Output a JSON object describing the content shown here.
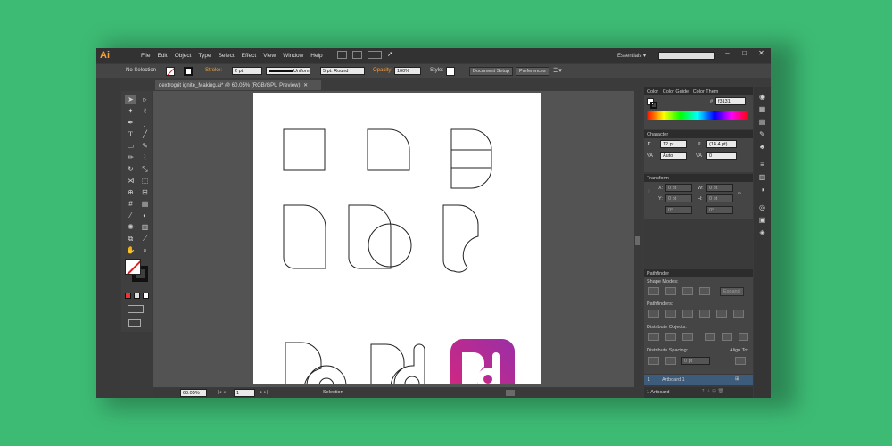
{
  "app": {
    "logo": "Ai"
  },
  "menu": [
    "File",
    "Edit",
    "Object",
    "Type",
    "Select",
    "Effect",
    "View",
    "Window",
    "Help"
  ],
  "workspace": {
    "label": "Essentials",
    "arrow": "▾"
  },
  "window_controls": {
    "minimize": "–",
    "maximize": "□",
    "close": "✕"
  },
  "control_bar": {
    "selection": "No Selection",
    "stroke_label": "Stroke:",
    "stroke_weight": "2 pt",
    "profile": "Uniform",
    "brush": "5 pt. Round",
    "opacity_label": "Opacity:",
    "opacity_value": "100%",
    "style_label": "Style:",
    "doc_setup": "Document Setup",
    "preferences": "Preferences"
  },
  "document_tab": {
    "title": "dextrogrit ignite_Making.ai* @ 60.05% (RGB/GPU Preview)",
    "close": "✕"
  },
  "color_panel": {
    "tabs": [
      "Color",
      "Color Guide",
      "Color Them"
    ],
    "hex_symbol": "#",
    "hex_value": "f3131"
  },
  "character_panel": {
    "title": "Character",
    "font_size": "12 pt",
    "leading": "(14.4 pt)",
    "kerning": "Auto",
    "tracking": "0"
  },
  "transform_panel": {
    "title": "Transform",
    "x_label": "X:",
    "x_value": "0 pt",
    "y_label": "Y:",
    "y_value": "0 pt",
    "w_label": "W:",
    "w_value": "0 pt",
    "h_label": "H:",
    "h_value": "0 pt",
    "angle": "0°",
    "shear": "0°"
  },
  "pathfinder_panel": {
    "title": "Pathfinder",
    "shape_modes": "Shape Modes:",
    "expand": "Expand",
    "pathfinders": "Pathfinders:",
    "distribute_objects": "Distribute Objects:",
    "distribute_spacing": "Distribute Spacing:",
    "spacing_value": "0 pt",
    "align_to": "Align To:"
  },
  "artboards_panel": {
    "row_number": "1",
    "row_name": "Artboard 1",
    "count": "1 Artboard"
  },
  "status_bar": {
    "zoom": "60.05%",
    "page": "1",
    "tool": "Selection"
  },
  "tools": [
    "selection-tool",
    "direct-selection-tool",
    "magic-wand-tool",
    "lasso-tool",
    "pen-tool",
    "curvature-tool",
    "type-tool",
    "line-segment-tool",
    "rectangle-tool",
    "paintbrush-tool",
    "pencil-tool",
    "shaper-tool",
    "rotate-tool",
    "scale-tool",
    "width-tool",
    "free-transform-tool",
    "shape-builder-tool",
    "perspective-grid-tool",
    "mesh-tool",
    "gradient-tool",
    "eyedropper-tool",
    "blend-tool",
    "symbol-sprayer-tool",
    "column-graph-tool",
    "artboard-tool",
    "slice-tool",
    "hand-tool",
    "zoom-tool"
  ],
  "colors": {
    "app_frame": "#3b3b3b",
    "canvas": "#535353",
    "background": "#3dbb74",
    "accent_orange": "#f79f38",
    "logo_gradient_start": "#d8267c",
    "logo_gradient_end": "#9a2fa6",
    "panel_selection": "#3d5b7a"
  }
}
